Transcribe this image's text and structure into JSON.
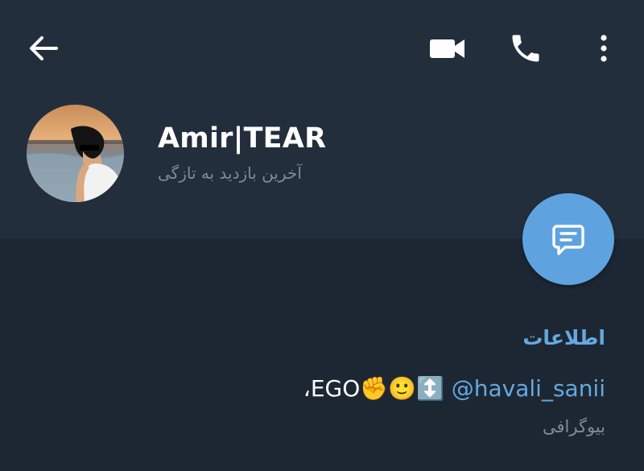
{
  "toolbar": {
    "back_icon": "arrow-left-icon",
    "video_icon": "video-camera-icon",
    "call_icon": "phone-icon",
    "more_icon": "more-vertical-icon"
  },
  "profile": {
    "name": "Amir|TEAR",
    "status": "آخرین بازدید به تازگی"
  },
  "fab": {
    "icon": "message-icon"
  },
  "info": {
    "title": "اطلاعات",
    "bio_text": "EGO✊🙂↕️",
    "bio_mention": "@havali_sanii",
    "bio_comma": "،",
    "bio_label": "بیوگرافی"
  },
  "colors": {
    "header_bg": "#232e3c",
    "body_bg": "#1d2733",
    "accent": "#64a9e0",
    "fab": "#5ea3e0",
    "muted": "#7f8b96"
  }
}
